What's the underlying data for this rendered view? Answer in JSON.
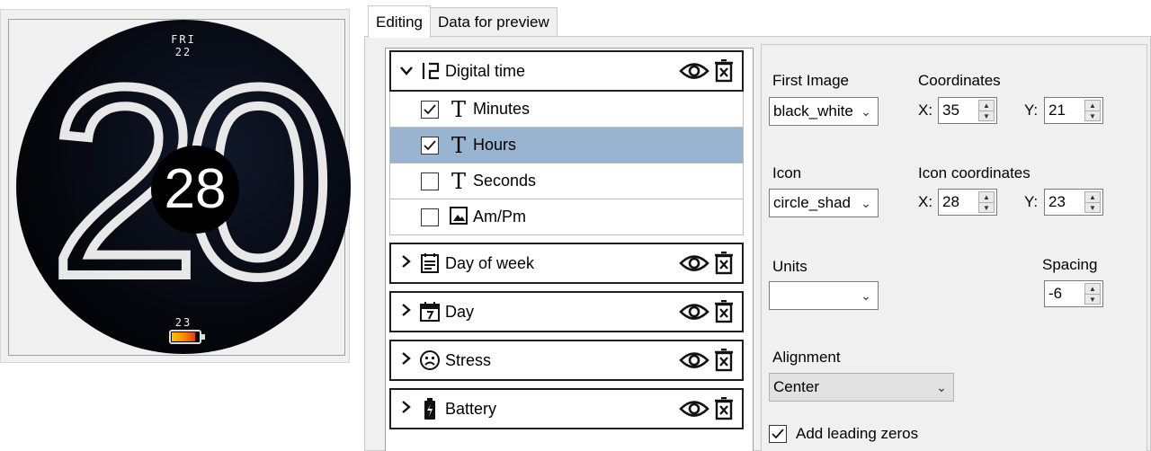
{
  "watchface": {
    "day_of_week": "FRI",
    "day": "22",
    "hours": "20",
    "minutes": "28",
    "steps": "23",
    "battery_level": 0.8,
    "battery_colors": [
      "#f4c400",
      "#ff8a00",
      "#e73b1e"
    ]
  },
  "tabs": [
    {
      "label": "Editing"
    },
    {
      "label": "Data for preview"
    }
  ],
  "tree": {
    "digital_time": {
      "label": "Digital time",
      "icon": "digital-12-icon",
      "subitems": [
        {
          "label": "Minutes",
          "checked": "☑",
          "icon": "text-T-icon"
        },
        {
          "label": "Hours",
          "checked": "☑",
          "icon": "text-T-icon"
        },
        {
          "label": "Seconds",
          "checked": "",
          "icon": "text-T-icon"
        },
        {
          "label": "Am/Pm",
          "checked": "",
          "icon": "image-icon"
        }
      ]
    },
    "groups": [
      {
        "label": "Day of week",
        "icon": "calendar-list-icon"
      },
      {
        "label": "Day",
        "icon": "calendar-7-icon"
      },
      {
        "label": "Stress",
        "icon": "sad-face-icon"
      },
      {
        "label": "Battery",
        "icon": "battery-icon"
      }
    ]
  },
  "props": {
    "first_image_label": "First Image",
    "first_image_value": "black_white",
    "coordinates_label": "Coordinates",
    "x_label": "X:",
    "y_label": "Y:",
    "coord_x": "35",
    "coord_y": "21",
    "icon_label": "Icon",
    "icon_value": "circle_shad",
    "icon_coordinates_label": "Icon coordinates",
    "icon_x": "28",
    "icon_y": "23",
    "units_label": "Units",
    "units_value": "",
    "spacing_label": "Spacing",
    "spacing_value": "-6",
    "alignment_label": "Alignment",
    "alignment_value": "Center",
    "leading_zeros_label": "Add leading zeros",
    "leading_zeros_checked": true
  },
  "colors": {
    "selection": "#99b4d1",
    "panel_bg": "#f0f0f0"
  }
}
